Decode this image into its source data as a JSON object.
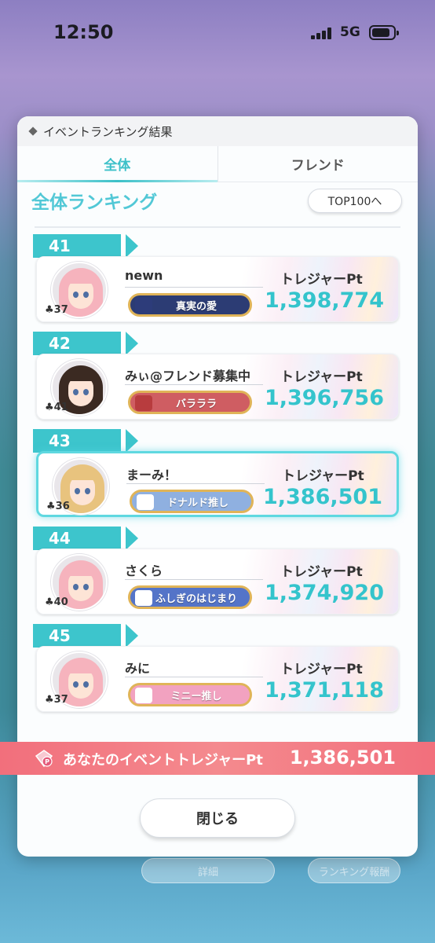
{
  "status_bar": {
    "time": "12:50",
    "network": "5G"
  },
  "modal": {
    "header": "イベントランキング結果",
    "tabs": [
      {
        "label": "全体",
        "active": true
      },
      {
        "label": "フレンド",
        "active": false
      }
    ],
    "section_title": "全体ランキング",
    "top100_button": "TOP100へ",
    "entries": [
      {
        "rank": "41",
        "name": "newn",
        "level": "37",
        "badge": "真実の愛",
        "pt_label": "トレジャーPt",
        "pt": "1,398,774",
        "highlight": false,
        "hair": "#f6b3bd",
        "badge_color": "#2c3c74",
        "badge_icon_color": "#2d3c7a"
      },
      {
        "rank": "42",
        "name": "みぃ@フレンド募集中",
        "level": "41",
        "badge": "バラララ",
        "pt_label": "トレジャーPt",
        "pt": "1,396,756",
        "highlight": false,
        "hair": "#3b2a22",
        "badge_color": "#cf5d62",
        "badge_icon_color": "#b83c3e"
      },
      {
        "rank": "43",
        "name": "まーみ！",
        "level": "36",
        "badge": "ドナルド推し",
        "pt_label": "トレジャーPt",
        "pt": "1,386,501",
        "highlight": true,
        "hair": "#e8c37e",
        "badge_color": "#8fb0e0",
        "badge_icon_color": "#ffffff"
      },
      {
        "rank": "44",
        "name": "さくら",
        "level": "40",
        "badge": "ふしぎのはじまり",
        "pt_label": "トレジャーPt",
        "pt": "1,374,920",
        "highlight": false,
        "hair": "#f6b3bd",
        "badge_color": "#5474c8",
        "badge_icon_color": "#ffffff"
      },
      {
        "rank": "45",
        "name": "みに",
        "level": "37",
        "badge": "ミニー推し",
        "pt_label": "トレジャーPt",
        "pt": "1,371,118",
        "highlight": false,
        "hair": "#f6b3bd",
        "badge_color": "#f2a2c0",
        "badge_icon_color": "#ffffff"
      }
    ],
    "your_points": {
      "label": "あなたのイベントトレジャーPt",
      "value": "1,386,501"
    },
    "close_button": "閉じる"
  },
  "background_buttons": {
    "left": "詳細",
    "right": "ランキング報酬"
  }
}
